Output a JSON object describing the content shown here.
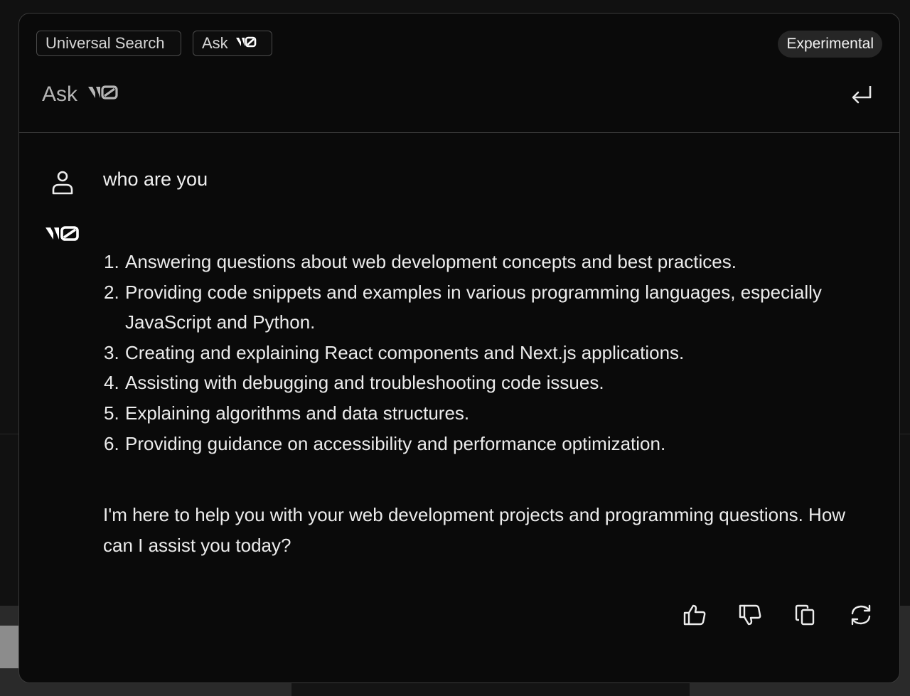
{
  "header": {
    "chips": [
      {
        "label": "Universal Search"
      },
      {
        "label": "Ask"
      }
    ],
    "badge": "Experimental"
  },
  "input": {
    "label": "Ask",
    "brand": "v0"
  },
  "conversation": {
    "user_message": "who are you",
    "assistant": {
      "brand": "v0",
      "list": [
        {
          "num": "1.",
          "text": "Answering questions about web development concepts and best practices."
        },
        {
          "num": "2.",
          "text": "Providing code snippets and examples in various programming languages, especially JavaScript and Python."
        },
        {
          "num": "3.",
          "text": "Creating and explaining React components and Next.js applications."
        },
        {
          "num": "4.",
          "text": "Assisting with debugging and troubleshooting code issues."
        },
        {
          "num": "5.",
          "text": "Explaining algorithms and data structures."
        },
        {
          "num": "6.",
          "text": "Providing guidance on accessibility and performance optimization."
        }
      ],
      "closing": "I'm here to help you with your web development projects and programming questions. How can I assist you today?"
    },
    "actions": [
      {
        "icon": "thumbs-up-icon"
      },
      {
        "icon": "thumbs-down-icon"
      },
      {
        "icon": "copy-icon"
      },
      {
        "icon": "regenerate-icon"
      }
    ]
  },
  "colors": {
    "modal_bg": "#0a0a0a",
    "border": "#3a3a3a",
    "text": "#ececec",
    "muted": "#b5b5b5",
    "badge_bg": "#262626"
  }
}
